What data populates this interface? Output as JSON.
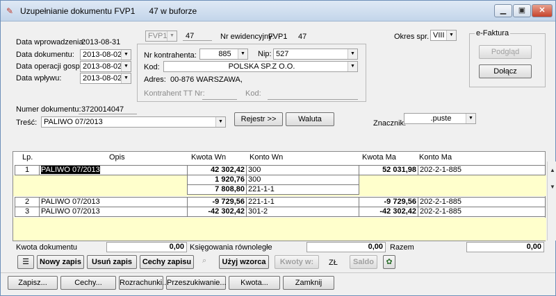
{
  "window": {
    "title": "Uzupełnianie dokumentu FVP1",
    "buffer": "47 w buforze",
    "minimize": "▁",
    "restore": "▣",
    "close": "✕"
  },
  "header": {
    "data_wprowadzenia_label": "Data wprowadzenia:",
    "data_wprowadzenia": "2013-08-31",
    "data_dokumentu_label": "Data dokumentu:",
    "data_dokumentu": "2013-08-02",
    "data_operacji_label": "Data operacji gosp.:",
    "data_operacji": "2013-08-02",
    "data_wplywu_label": "Data wpływu:",
    "data_wplywu": "2013-08-02",
    "typ": "FVP1",
    "numer": "47",
    "nr_ewid_label": "Nr ewidencyjny:",
    "nr_ewid": "FVP1",
    "nr_ewid_num": "47",
    "okres_label": "Okres spr.",
    "okres": "VIII",
    "nr_kontrahenta_label": "Nr kontrahenta:",
    "nr_kontrahenta": "885",
    "nip_label": "Nip:",
    "nip": "527",
    "kod_label": "Kod:",
    "kod": "POLSKA SP.Z O.O.",
    "adres_label": "Adres:",
    "adres": "00-876 WARSZAWA,",
    "kontrahent_tt_label": "Kontrahent TT Nr:",
    "kod2_label": "Kod:",
    "numer_dok_label": "Numer dokumentu:",
    "numer_dok": "3720014047",
    "tresc_label": "Treść:",
    "tresc": "PALIWO 07/2013",
    "rejestr_btn": "Rejestr >>",
    "waluta_btn": "Waluta",
    "znacznik_label": "Znacznik:",
    "znacznik": ".puste",
    "efaktura_label": "e-Faktura",
    "podglad_btn": "Podgląd",
    "dolacz_btn": "Dołącz"
  },
  "grid": {
    "headers": {
      "lp": "Lp.",
      "opis": "Opis",
      "kwota_wn": "Kwota Wn",
      "konto_wn": "Konto Wn",
      "kwota_ma": "Kwota Ma",
      "konto_ma": "Konto Ma"
    },
    "rows": [
      {
        "lp": "1",
        "opis": "PALIWO 07/2013",
        "wn": [
          {
            "kwota": "42 302,42",
            "konto": "300"
          },
          {
            "kwota": "1 920,76",
            "konto": "300"
          },
          {
            "kwota": "7 808,80",
            "konto": "221-1-1"
          }
        ],
        "kwota_ma": "52 031,98",
        "konto_ma": "202-2-1-885"
      },
      {
        "lp": "2",
        "opis": "PALIWO 07/2013",
        "wn": [
          {
            "kwota": "-9 729,56",
            "konto": "221-1-1"
          }
        ],
        "kwota_ma": "-9 729,56",
        "konto_ma": "202-2-1-885"
      },
      {
        "lp": "3",
        "opis": "PALIWO 07/2013",
        "wn": [
          {
            "kwota": "-42 302,42",
            "konto": "301-2"
          }
        ],
        "kwota_ma": "-42 302,42",
        "konto_ma": "202-2-1-885"
      }
    ]
  },
  "totals": {
    "kwota_dok_label": "Kwota dokumentu",
    "kwota_dok": "0,00",
    "ksieg_label": "Księgowania równoległe",
    "ksieg": "0,00",
    "razem_label": "Razem",
    "razem": "0,00"
  },
  "toolbar": {
    "nowy_zapis": "Nowy zapis",
    "usun_zapis": "Usuń zapis",
    "cechy_zapisu": "Cechy zapisu",
    "uzyj_wzorca": "Użyj wzorca",
    "kwoty_w": "Kwoty w:",
    "zl": "ZŁ",
    "saldo": "Saldo"
  },
  "bottom": {
    "zapisz": "Zapisz...",
    "cechy": "Cechy...",
    "rozrachunki": "Rozrachunki...",
    "przeszukiwanie": "Przeszukiwanie...",
    "kwota": "Kwota...",
    "zamknij": "Zamknij"
  }
}
